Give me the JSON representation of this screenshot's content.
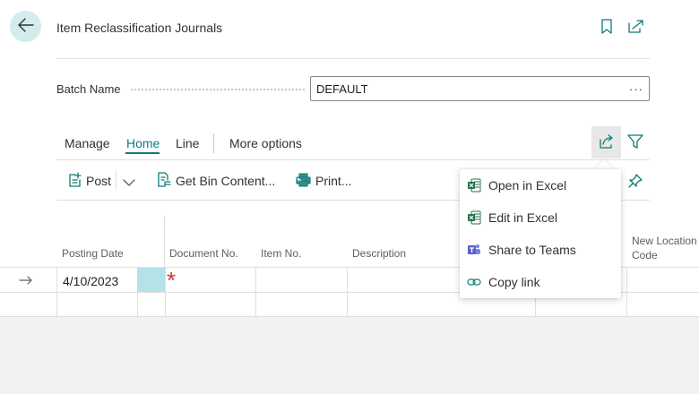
{
  "header": {
    "title": "Item Reclassification Journals"
  },
  "batch": {
    "label": "Batch Name",
    "value": "DEFAULT",
    "more": "···"
  },
  "tabs": [
    {
      "label": "Manage"
    },
    {
      "label": "Home"
    },
    {
      "label": "Line"
    },
    {
      "label": "More options"
    }
  ],
  "actions": {
    "post": "Post",
    "get_bin_content": "Get Bin Content...",
    "print": "Print..."
  },
  "columns": [
    {
      "label": "Posting Date"
    },
    {
      "label": "Document No."
    },
    {
      "label": "Item No."
    },
    {
      "label": "Description"
    },
    {
      "label": "New Location\nCode"
    }
  ],
  "rows": [
    {
      "posting_date": "4/10/2023",
      "required_marker": "*"
    }
  ],
  "share_menu": {
    "items": [
      {
        "label": "Open in Excel",
        "icon": "excel-icon"
      },
      {
        "label": "Edit in Excel",
        "icon": "excel-icon"
      },
      {
        "label": "Share to Teams",
        "icon": "teams-icon"
      },
      {
        "label": "Copy link",
        "icon": "link-icon"
      }
    ]
  },
  "colors": {
    "accent": "#0e7a7a",
    "back_bg": "#d3ecee",
    "selected_cell": "#b3e3e8",
    "required": "#d13438",
    "excel": "#217346",
    "teams": "#5b5fc7"
  }
}
